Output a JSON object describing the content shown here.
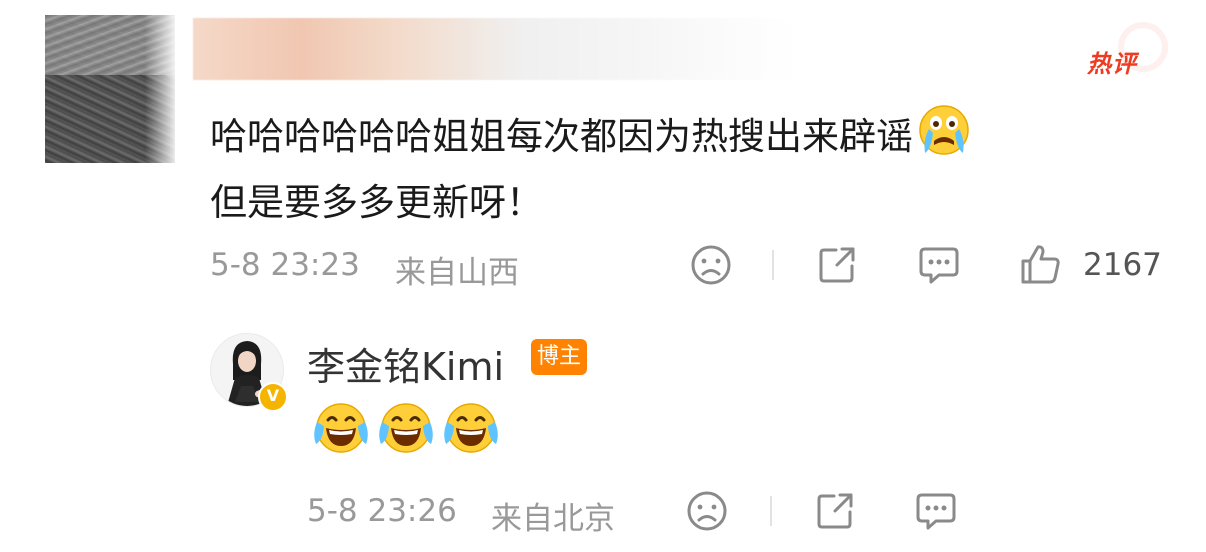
{
  "comment": {
    "hot_label": "热评",
    "text_line1": "哈哈哈哈哈哈姐姐每次都因为热搜出来辟谣",
    "text_line2": "但是要多多更新呀！",
    "time": "5-8 23:23",
    "location": "来自山西",
    "like_count": "2167",
    "icons": [
      "sad-face-icon",
      "share-icon",
      "comment-icon",
      "like-icon"
    ]
  },
  "reply": {
    "author": "李金铭Kimi",
    "badge": "博主",
    "verified_mark": "V",
    "time": "5-8 23:26",
    "location": "来自北京",
    "emoji": [
      "laugh-cry-emoji",
      "laugh-cry-emoji",
      "laugh-cry-emoji"
    ],
    "icons": [
      "sad-face-icon",
      "share-icon",
      "comment-icon"
    ]
  },
  "colors": {
    "hot": "#ee3b22",
    "author_badge": "#ff8200",
    "verified": "#f5b400",
    "meta_text": "#999999"
  }
}
